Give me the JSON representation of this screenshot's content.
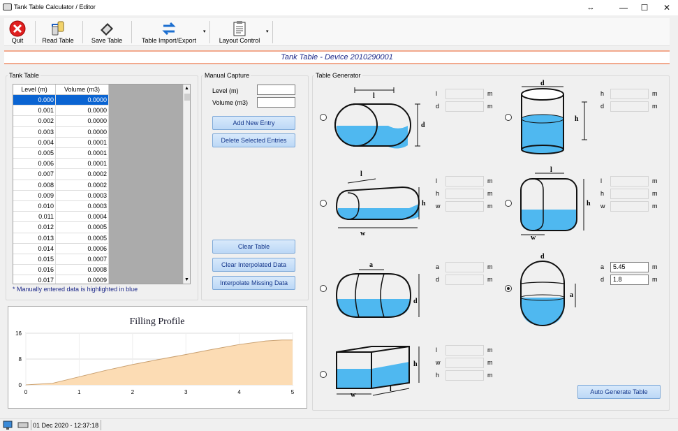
{
  "window": {
    "title": "Tank Table Calculator / Editor",
    "controls": [
      "↔",
      "—",
      "☐",
      "✕"
    ]
  },
  "toolbar": {
    "quit": "Quit",
    "read": "Read Table",
    "save": "Save Table",
    "import_export": "Table Import/Export",
    "layout": "Layout Control"
  },
  "banner": "Tank Table - Device 2010290001",
  "tank_table": {
    "group_title": "Tank Table",
    "columns": [
      "Level (m)",
      "Volume (m3)"
    ],
    "rows": [
      [
        "0.000",
        "0.0000"
      ],
      [
        "0.001",
        "0.0000"
      ],
      [
        "0.002",
        "0.0000"
      ],
      [
        "0.003",
        "0.0000"
      ],
      [
        "0.004",
        "0.0001"
      ],
      [
        "0.005",
        "0.0001"
      ],
      [
        "0.006",
        "0.0001"
      ],
      [
        "0.007",
        "0.0002"
      ],
      [
        "0.008",
        "0.0002"
      ],
      [
        "0.009",
        "0.0003"
      ],
      [
        "0.010",
        "0.0003"
      ],
      [
        "0.011",
        "0.0004"
      ],
      [
        "0.012",
        "0.0005"
      ],
      [
        "0.013",
        "0.0005"
      ],
      [
        "0.014",
        "0.0006"
      ],
      [
        "0.015",
        "0.0007"
      ],
      [
        "0.016",
        "0.0008"
      ],
      [
        "0.017",
        "0.0009"
      ]
    ],
    "note": "* Manually entered data is highlighted in blue"
  },
  "manual": {
    "group_title": "Manual Capture",
    "level_label": "Level (m)",
    "volume_label": "Volume (m3)",
    "level_value": "",
    "volume_value": "",
    "add": "Add New Entry",
    "delete": "Delete  Selected Entries",
    "clear": "Clear Table",
    "clear_interp": "Clear Interpolated Data",
    "interp": "Interpolate Missing Data"
  },
  "generator": {
    "group_title": "Table Generator",
    "unit": "m",
    "shape1": {
      "fields": [
        "l",
        "d"
      ],
      "labels": [
        "l",
        "d"
      ]
    },
    "shape2": {
      "fields": [
        "h",
        "d"
      ],
      "labels": [
        "h",
        "d"
      ]
    },
    "shape3": {
      "labels": [
        "l",
        "h",
        "w"
      ]
    },
    "shape4": {
      "labels": [
        "l",
        "h",
        "w"
      ]
    },
    "shape5": {
      "labels": [
        "a",
        "d"
      ]
    },
    "shape6": {
      "labels": [
        "a",
        "d"
      ],
      "values": [
        "5.45",
        "1.8"
      ]
    },
    "shape7": {
      "labels": [
        "l",
        "w",
        "h"
      ]
    },
    "diagram_labels": {
      "l": "l",
      "d": "d",
      "h": "h",
      "w": "w",
      "a": "a"
    },
    "auto": "Auto Generate Table"
  },
  "chart_data": {
    "type": "area",
    "title": "Filling Profile",
    "x": [
      0,
      0.5,
      1,
      1.5,
      2,
      2.5,
      3,
      3.5,
      4,
      4.5,
      4.8,
      5
    ],
    "y": [
      0,
      0.5,
      2.5,
      4.5,
      6.3,
      7.9,
      9.4,
      11.0,
      12.5,
      13.6,
      13.9,
      13.9
    ],
    "xticks": [
      "0",
      "1",
      "2",
      "3",
      "4",
      "5"
    ],
    "yticks": [
      "16",
      "8",
      "0"
    ],
    "xlim": [
      0,
      5
    ],
    "ylim": [
      0,
      16
    ],
    "fill": "#fcdcb4",
    "stroke": "#c9a070"
  },
  "status": {
    "datetime": "01 Dec 2020 - 12:37:18"
  },
  "colors": {
    "selected": "#0a64d2",
    "water": "#4fb8f0",
    "banner_text": "#1e2a8a"
  }
}
